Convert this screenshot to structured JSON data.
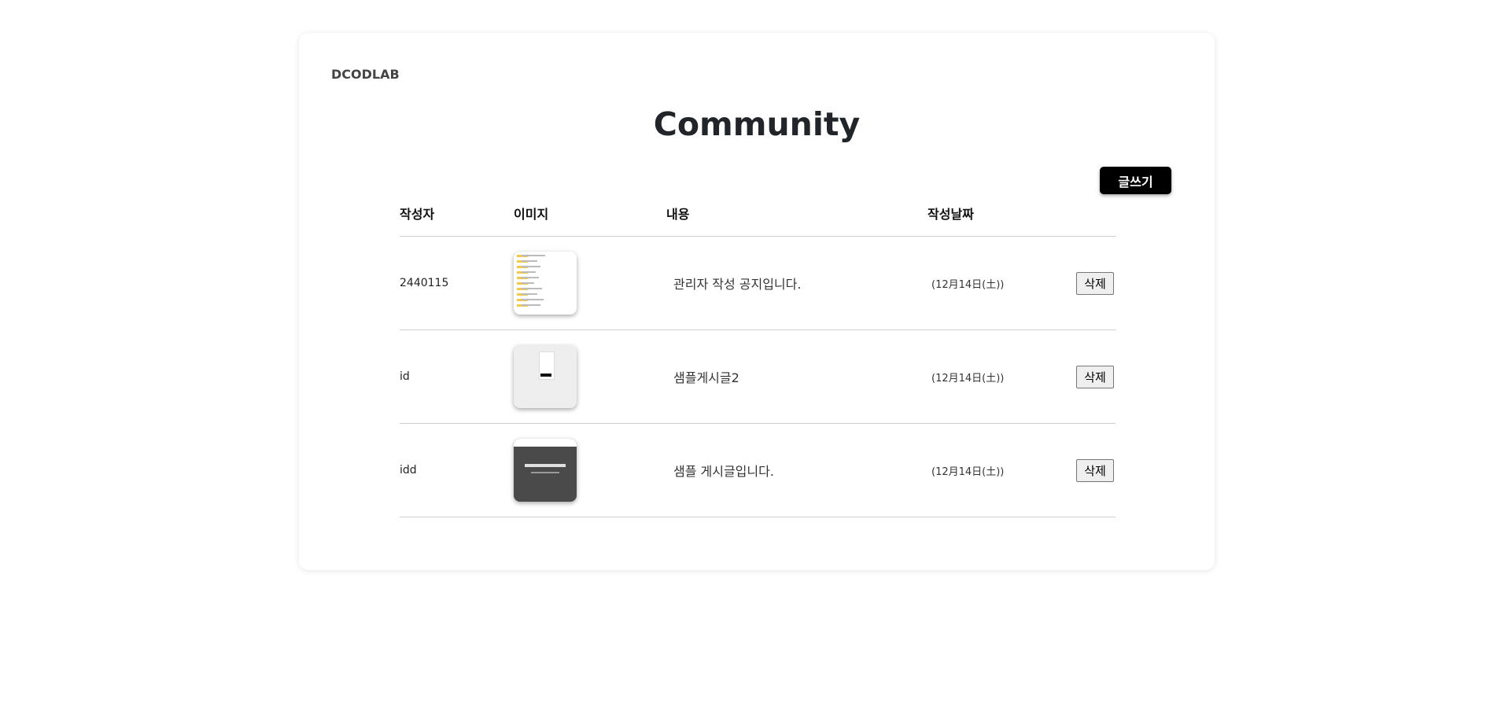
{
  "header": {
    "brand": "DCODLAB",
    "title": "Community",
    "write_label": "글쓰기"
  },
  "table": {
    "columns": {
      "author": "작성자",
      "image": "이미지",
      "content": "내용",
      "date": "작성날짜"
    },
    "rows": [
      {
        "author": "2440115",
        "thumbnail": "file-list-screenshot",
        "content": "관리자 작성 공지입니다.",
        "date": "(12月14日(土))",
        "delete_label": "삭제"
      },
      {
        "author": "id",
        "thumbnail": "mobile-page-screenshot",
        "content": "샘플게시글2",
        "date": "(12月14日(土))",
        "delete_label": "삭제"
      },
      {
        "author": "idd",
        "thumbnail": "dark-landing-page-screenshot",
        "content": "샘플 게시글입니다.",
        "date": "(12月14日(土))",
        "delete_label": "삭제"
      }
    ]
  },
  "colors": {
    "accent_button": "#000000",
    "divider": "#cfcfcf"
  }
}
